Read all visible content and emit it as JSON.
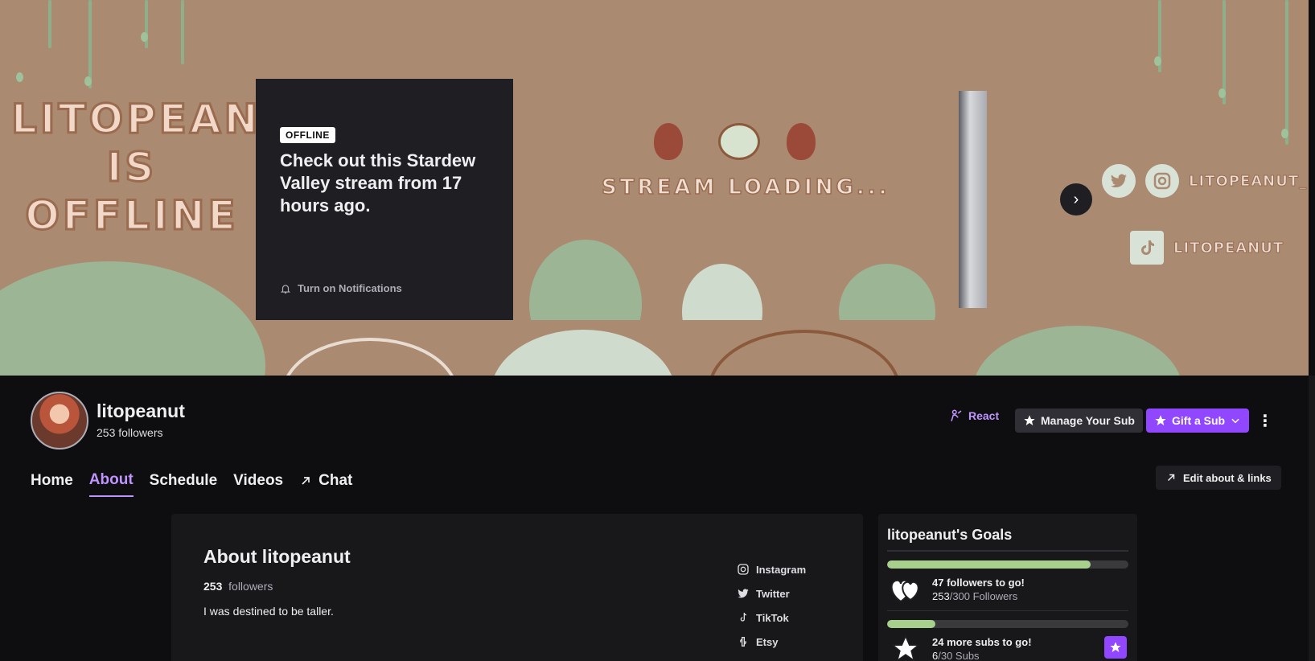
{
  "banner": {
    "title": "LITOPEANUT\nIS\nOFFLINE",
    "socials": [
      {
        "icon": "twitter-icon",
        "glyph": "t"
      },
      {
        "icon": "instagram-icon",
        "glyph": "◎"
      }
    ],
    "social_handle": "LITOPEANUT_",
    "tiktok_handle": "LITOPEANUT"
  },
  "offline_card": {
    "badge": "OFFLINE",
    "headline": "Check out this Stardew Valley stream from 17 hours ago.",
    "notifications_label": "Turn on Notifications"
  },
  "preview": {
    "text": "STREAM LOADING..."
  },
  "channel": {
    "name": "litopeanut",
    "followers": "253 followers"
  },
  "actions": {
    "react": "React",
    "manage_sub": "Manage Your Sub",
    "gift_sub": "Gift a Sub"
  },
  "tabs": [
    {
      "label": "Home"
    },
    {
      "label": "About",
      "active": true
    },
    {
      "label": "Schedule"
    },
    {
      "label": "Videos"
    },
    {
      "label": "Chat"
    }
  ],
  "edit_button": "Edit about & links",
  "about": {
    "title": "About litopeanut",
    "follower_count": "253",
    "follower_word": "followers",
    "bio": "I was destined to be taller.",
    "links": [
      {
        "label": "Instagram",
        "icon": "instagram-icon"
      },
      {
        "label": "Twitter",
        "icon": "twitter-icon"
      },
      {
        "label": "TikTok",
        "icon": "tiktok-icon"
      },
      {
        "label": "Etsy",
        "icon": "etsy-icon"
      }
    ]
  },
  "goals": {
    "title": "litopeanut's Goals",
    "items": [
      {
        "headline": "47 followers to go!",
        "current": "253",
        "rest": "/300 Followers",
        "progress": 0.843,
        "icon": "hearts-icon"
      },
      {
        "headline": "24 more subs to go!",
        "current": "6",
        "rest": "/30 Subs",
        "progress": 0.2,
        "icon": "star-icon"
      }
    ]
  },
  "colors": {
    "accent": "#bf94ff",
    "primary": "#9147ff",
    "goal": "#a8d08d",
    "banner": "#ab8a72"
  }
}
